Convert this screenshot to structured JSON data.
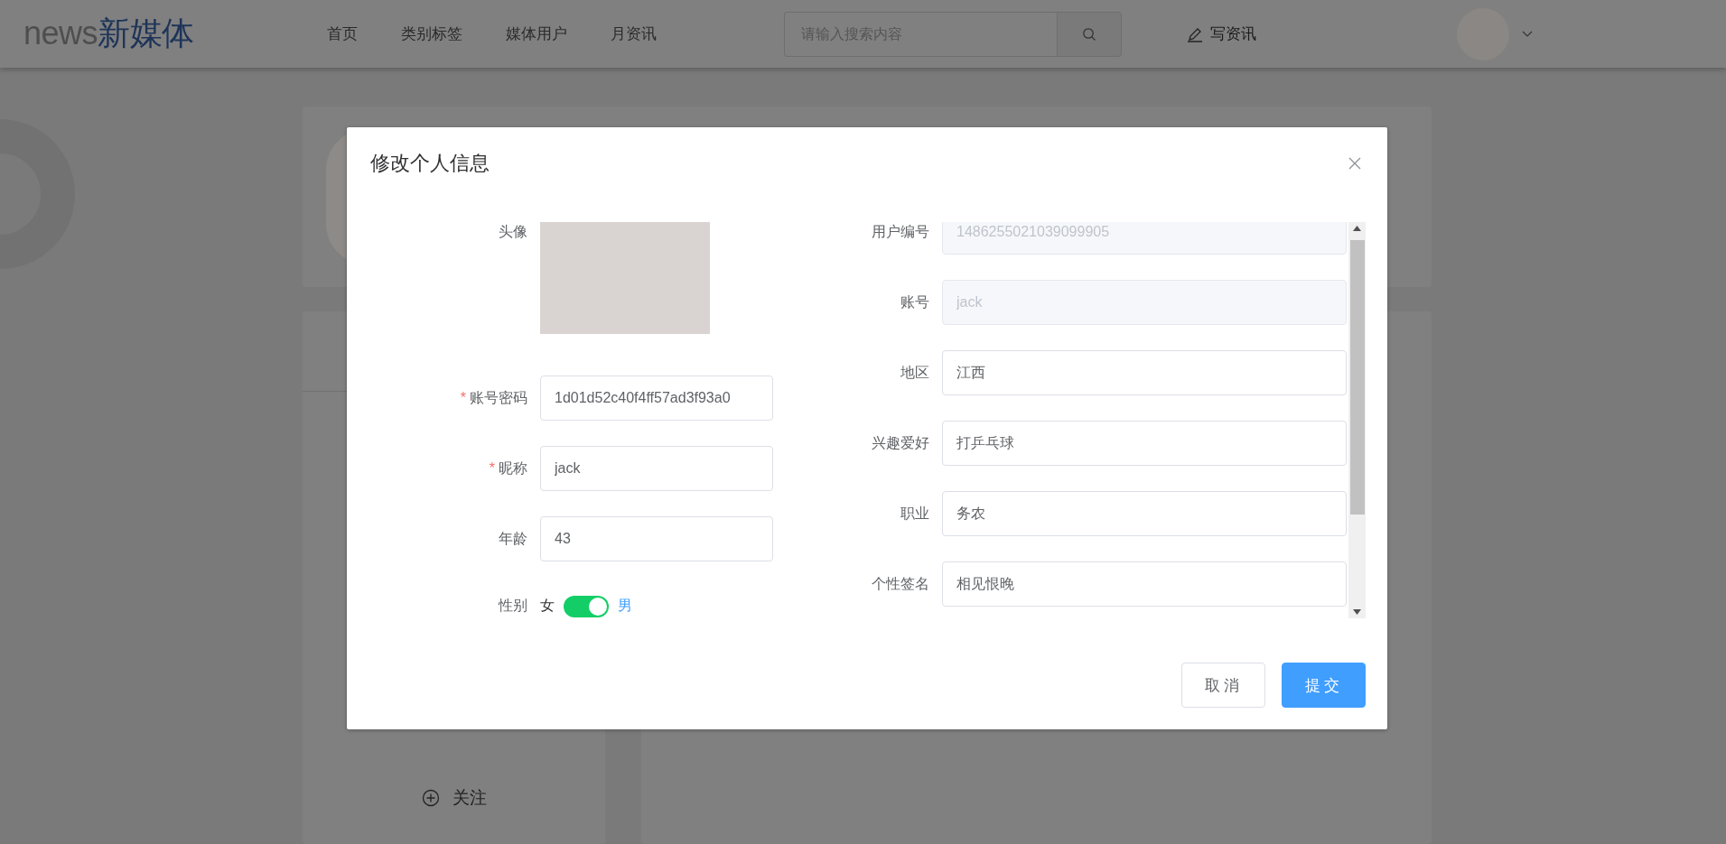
{
  "header": {
    "logo_latin": "news",
    "logo_cjk": "新媒体",
    "nav": [
      {
        "label": "首页"
      },
      {
        "label": "类别标签"
      },
      {
        "label": "媒体用户"
      },
      {
        "label": "月资讯"
      }
    ],
    "search": {
      "placeholder": "请输入搜索内容"
    },
    "write_link": "写资讯"
  },
  "profile_card": {
    "follow_label": "关注"
  },
  "dialog": {
    "title": "修改个人信息",
    "avatar_label": "头像",
    "required_mark": "*",
    "left_fields": [
      {
        "label": "账号密码",
        "value": "1d01d52c40f4ff57ad3f93a0",
        "required": true,
        "disabled": false
      },
      {
        "label": "昵称",
        "value": "jack",
        "required": true,
        "disabled": false
      },
      {
        "label": "年龄",
        "value": "43",
        "required": false,
        "disabled": false
      }
    ],
    "gender": {
      "label": "性别",
      "inactive_label": "女",
      "active_label": "男",
      "on": true
    },
    "right_fields": [
      {
        "label": "用户编号",
        "value": "1486255021039099905",
        "required": false,
        "disabled": true
      },
      {
        "label": "账号",
        "value": "jack",
        "required": false,
        "disabled": true
      },
      {
        "label": "地区",
        "value": "江西",
        "required": false,
        "disabled": false
      },
      {
        "label": "兴趣爱好",
        "value": "打乒乓球",
        "required": false,
        "disabled": false
      },
      {
        "label": "职业",
        "value": "务农",
        "required": false,
        "disabled": false
      },
      {
        "label": "个性签名",
        "value": "相见恨晚",
        "required": false,
        "disabled": false
      }
    ],
    "buttons": [
      {
        "label": "取消",
        "kind": "default"
      },
      {
        "label": "提交",
        "kind": "primary"
      }
    ]
  }
}
